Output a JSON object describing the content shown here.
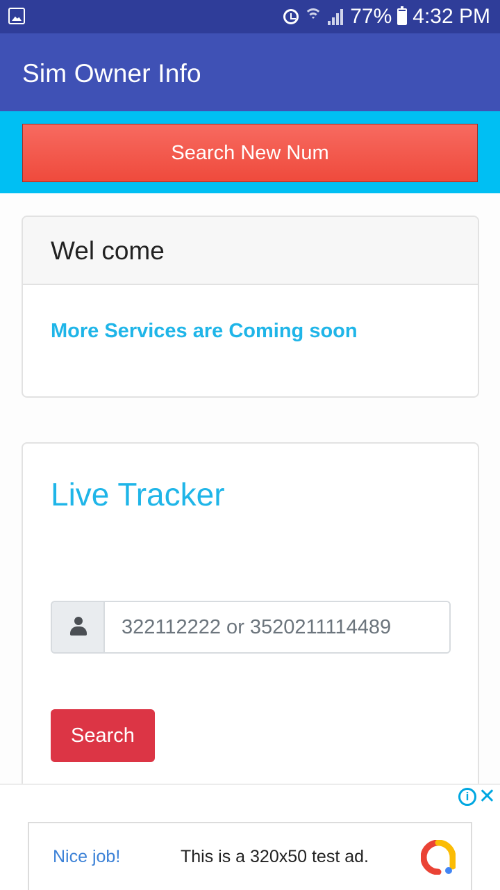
{
  "status_bar": {
    "battery_percent": "77%",
    "time": "4:32 PM",
    "icons": [
      "gallery-icon",
      "alarm-icon",
      "wifi-icon",
      "signal-icon",
      "battery-charging-icon"
    ]
  },
  "app_bar": {
    "title": "Sim Owner Info"
  },
  "actions": {
    "search_new_label": "Search New Num"
  },
  "welcome_card": {
    "header": "Wel come",
    "message": "More Services are Coming soon"
  },
  "tracker_card": {
    "title": "Live Tracker",
    "input_placeholder": "322112222 or 3520211114489",
    "input_icon": "user-icon",
    "search_label": "Search"
  },
  "ad": {
    "nice_text": "Nice job!",
    "body_text": "This is a 320x50 test ad.",
    "info_icon": "info-icon",
    "close_icon": "close-icon"
  },
  "colors": {
    "status_bar": "#2f3d99",
    "app_bar": "#3f51b5",
    "cyan_strip": "#00bff3",
    "primary_button": "#ef4a3c",
    "accent_text": "#1fb5e8",
    "search_button": "#dc3545"
  }
}
